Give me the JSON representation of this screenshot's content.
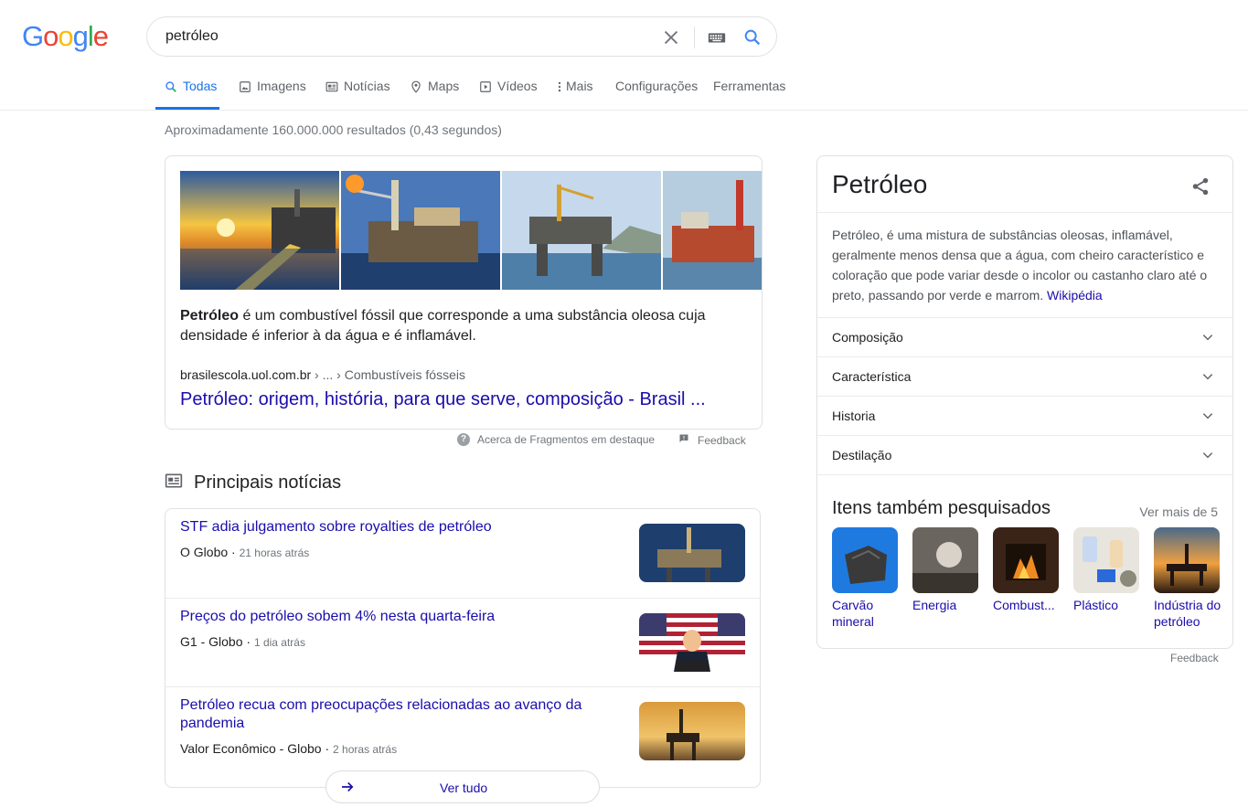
{
  "logo": "Google",
  "search": {
    "value": "petróleo"
  },
  "tabs": [
    {
      "label": "Todas"
    },
    {
      "label": "Imagens"
    },
    {
      "label": "Notícias"
    },
    {
      "label": "Maps"
    },
    {
      "label": "Vídeos"
    },
    {
      "label": "Mais"
    },
    {
      "label": "Configurações"
    },
    {
      "label": "Ferramentas"
    }
  ],
  "stats": "Aproximadamente 160.000.000 resultados (0,43 segundos)",
  "snippet": {
    "bold": "Petróleo",
    "text": " é um combustível fóssil que corresponde a uma substância oleosa cuja densidade é inferior à da água e é inflamável.",
    "domain": "brasilescola.uol.com.br",
    "path": " › ... › Combustíveis fósseis",
    "title": "Petróleo: origem, história, para que serve, composição - Brasil ...",
    "about": "Acerca de Fragmentos em destaque",
    "feedback": "Feedback"
  },
  "news": {
    "heading": "Principais notícias",
    "items": [
      {
        "title": "STF adia julgamento sobre royalties de petróleo",
        "source": "O Globo",
        "time": "21 horas atrás"
      },
      {
        "title": "Preços do petróleo sobem 4% nesta quarta-feira",
        "source": "G1 - Globo",
        "time": "1 dia atrás"
      },
      {
        "title": "Petróleo recua com preocupações relacionadas ao avanço da pandemia",
        "source": "Valor Econômico - Globo",
        "time": "2 horas atrás"
      }
    ],
    "see_all": "Ver tudo"
  },
  "panel": {
    "title": "Petróleo",
    "description": "Petróleo, é uma mistura de substâncias oleosas, inflamável, geralmente menos densa que a água, com cheiro característico e coloração que pode variar desde o incolor ou castanho claro até o preto, passando por verde e marrom. ",
    "wiki": "Wikipédia",
    "rows": [
      {
        "label": "Composição"
      },
      {
        "label": "Característica"
      },
      {
        "label": "Historia"
      },
      {
        "label": "Destilação"
      }
    ],
    "pasf_title": "Itens também pesquisados",
    "pasf_more": "Ver mais de 5",
    "pasf": [
      {
        "label": "Carvão mineral"
      },
      {
        "label": "Energia"
      },
      {
        "label": "Combust..."
      },
      {
        "label": "Plástico"
      },
      {
        "label": "Indústria do petróleo"
      }
    ],
    "feedback": "Feedback"
  }
}
